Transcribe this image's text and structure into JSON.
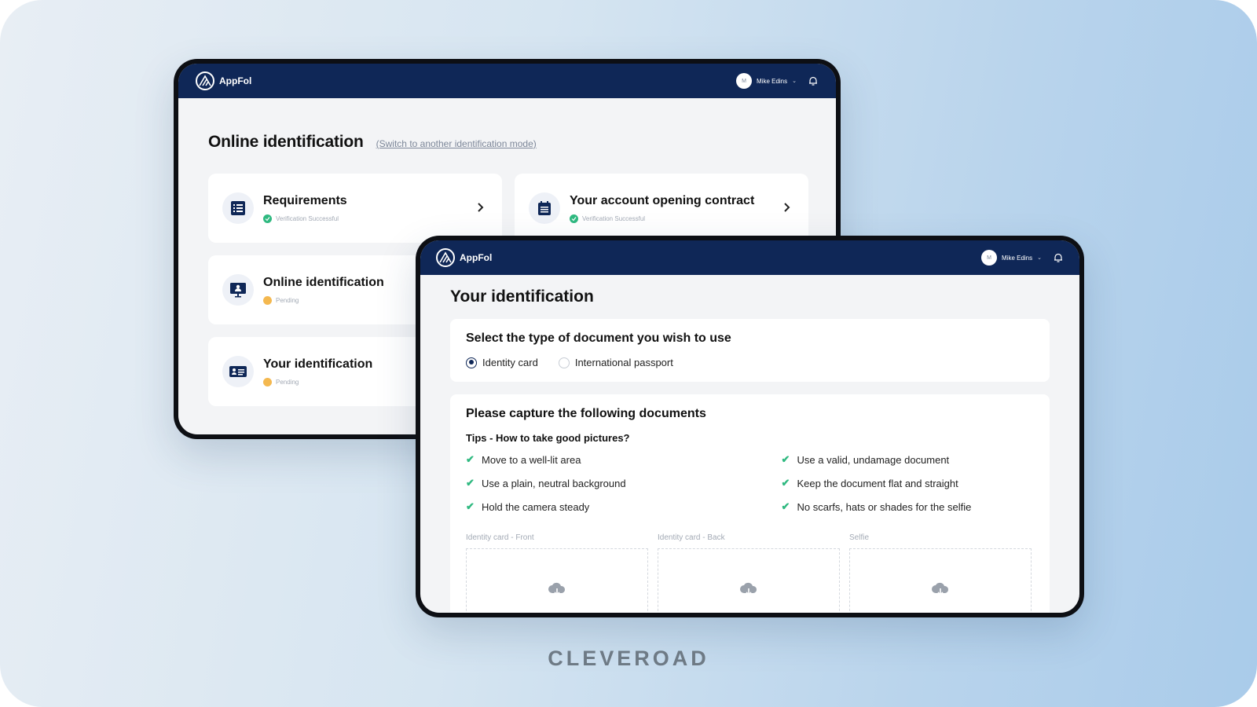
{
  "brand": "CLEVEROAD",
  "appbar": {
    "app_name": "AppFol",
    "user_initial": "M",
    "user_name": "Mike Edins"
  },
  "back_screen": {
    "title": "Online identification",
    "switch_link": "(Switch to another identification mode)",
    "cards": [
      {
        "title": "Requirements",
        "status": "Verification Successful",
        "state": "ok",
        "icon": "list-icon"
      },
      {
        "title": "Your account opening contract",
        "status": "Verification Successful",
        "state": "ok",
        "icon": "calendar-icon"
      },
      {
        "title": "Online identification",
        "status": "Pending",
        "state": "pending",
        "icon": "monitor-user-icon"
      },
      {
        "title": "Your identification",
        "status": "Pending",
        "state": "pending",
        "icon": "id-card-icon"
      }
    ]
  },
  "front_screen": {
    "title": "Your identification",
    "doc_type": {
      "title": "Select the type of document you wish to use",
      "options": [
        {
          "label": "Identity card",
          "selected": true
        },
        {
          "label": "International passport",
          "selected": false
        }
      ]
    },
    "capture": {
      "title": "Please capture the following documents",
      "tips_title": "Tips - How to take good pictures?",
      "tips_left": [
        "Move to a well-lit area",
        "Use a plain, neutral background",
        "Hold the camera steady"
      ],
      "tips_right": [
        "Use a valid, undamage document",
        "Keep the document flat and straight",
        "No scarfs, hats or shades for the selfie"
      ],
      "uploads": [
        "Identity card - Front",
        "Identity card - Back",
        "Selfie"
      ]
    }
  },
  "colors": {
    "appbar": "#0f2757",
    "success": "#2fb980",
    "pending": "#f4b84f"
  }
}
